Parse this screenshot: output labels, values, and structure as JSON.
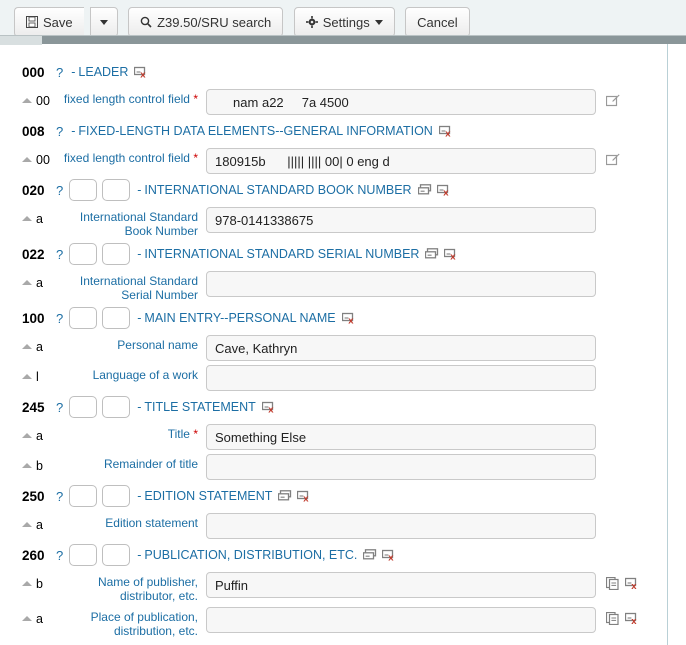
{
  "toolbar": {
    "save_label": "Save",
    "save_icon": "floppy-disk-icon",
    "save_dropdown_icon": "caret-down-icon",
    "search_label": "Z39.50/SRU search",
    "search_icon": "magnifier-icon",
    "settings_label": "Settings",
    "settings_icon": "gear-icon",
    "settings_caret_icon": "caret-down-icon",
    "cancel_label": "Cancel"
  },
  "icons": {
    "help": "?",
    "delete_tag": "tag-delete-icon",
    "repeat_tag": "tag-repeat-icon",
    "edit_control_field": "control-field-editor-icon",
    "clone_subfield": "subfield-clone-icon",
    "delete_subfield": "subfield-delete-icon",
    "collapse": "collapse-triangle-icon"
  },
  "fields": [
    {
      "tag": "000",
      "description": "LEADER",
      "has_indicators": false,
      "indicator1": "",
      "indicator2": "",
      "repeatable": false,
      "deletable": true,
      "subfields": [
        {
          "code": "00",
          "label": "fixed length control field",
          "required": true,
          "value": "     nam a22     7a 4500",
          "editor_icon": true,
          "clone_icon": false,
          "delete_icon": false
        }
      ]
    },
    {
      "tag": "008",
      "description": "FIXED-LENGTH DATA ELEMENTS--GENERAL INFORMATION",
      "has_indicators": false,
      "indicator1": "",
      "indicator2": "",
      "repeatable": false,
      "deletable": true,
      "subfields": [
        {
          "code": "00",
          "label": "fixed length control field",
          "required": true,
          "value": "180915b      ||||| |||| 00| 0 eng d",
          "editor_icon": true,
          "clone_icon": false,
          "delete_icon": false
        }
      ]
    },
    {
      "tag": "020",
      "description": "INTERNATIONAL STANDARD BOOK NUMBER",
      "has_indicators": true,
      "indicator1": "",
      "indicator2": "",
      "repeatable": true,
      "deletable": true,
      "subfields": [
        {
          "code": "a",
          "label": "International Standard Book Number",
          "required": false,
          "value": "978-0141338675",
          "editor_icon": false,
          "clone_icon": false,
          "delete_icon": false
        }
      ]
    },
    {
      "tag": "022",
      "description": "INTERNATIONAL STANDARD SERIAL NUMBER",
      "has_indicators": true,
      "indicator1": "",
      "indicator2": "",
      "repeatable": true,
      "deletable": true,
      "subfields": [
        {
          "code": "a",
          "label": "International Standard Serial Number",
          "required": false,
          "value": "",
          "editor_icon": false,
          "clone_icon": false,
          "delete_icon": false
        }
      ]
    },
    {
      "tag": "100",
      "description": "MAIN ENTRY--PERSONAL NAME",
      "has_indicators": true,
      "indicator1": "",
      "indicator2": "",
      "repeatable": false,
      "deletable": true,
      "subfields": [
        {
          "code": "a",
          "label": "Personal name",
          "required": false,
          "value": "Cave, Kathryn",
          "editor_icon": false,
          "clone_icon": false,
          "delete_icon": false
        },
        {
          "code": "l",
          "label": "Language of a work",
          "required": false,
          "value": "",
          "editor_icon": false,
          "clone_icon": false,
          "delete_icon": false
        }
      ]
    },
    {
      "tag": "245",
      "description": "TITLE STATEMENT",
      "has_indicators": true,
      "indicator1": "",
      "indicator2": "",
      "repeatable": false,
      "deletable": true,
      "subfields": [
        {
          "code": "a",
          "label": "Title",
          "required": true,
          "value": "Something Else",
          "editor_icon": false,
          "clone_icon": false,
          "delete_icon": false
        },
        {
          "code": "b",
          "label": "Remainder of title",
          "required": false,
          "value": "",
          "editor_icon": false,
          "clone_icon": false,
          "delete_icon": false
        }
      ]
    },
    {
      "tag": "250",
      "description": "EDITION STATEMENT",
      "has_indicators": true,
      "indicator1": "",
      "indicator2": "",
      "repeatable": true,
      "deletable": true,
      "subfields": [
        {
          "code": "a",
          "label": "Edition statement",
          "required": false,
          "value": "",
          "editor_icon": false,
          "clone_icon": false,
          "delete_icon": false
        }
      ]
    },
    {
      "tag": "260",
      "description": "PUBLICATION, DISTRIBUTION, ETC.",
      "has_indicators": true,
      "indicator1": "",
      "indicator2": "",
      "repeatable": true,
      "deletable": true,
      "subfields": [
        {
          "code": "b",
          "label": "Name of publisher, distributor, etc.",
          "required": false,
          "value": "Puffin",
          "editor_icon": false,
          "clone_icon": true,
          "delete_icon": true
        },
        {
          "code": "a",
          "label": "Place of publication, distribution, etc.",
          "required": false,
          "value": "",
          "editor_icon": false,
          "clone_icon": true,
          "delete_icon": true
        }
      ]
    }
  ],
  "colors": {
    "link": "#1c6ea4",
    "toolbar_bg": "#eef3f4",
    "required": "#cc0000",
    "delete_x": "#c0392b"
  }
}
